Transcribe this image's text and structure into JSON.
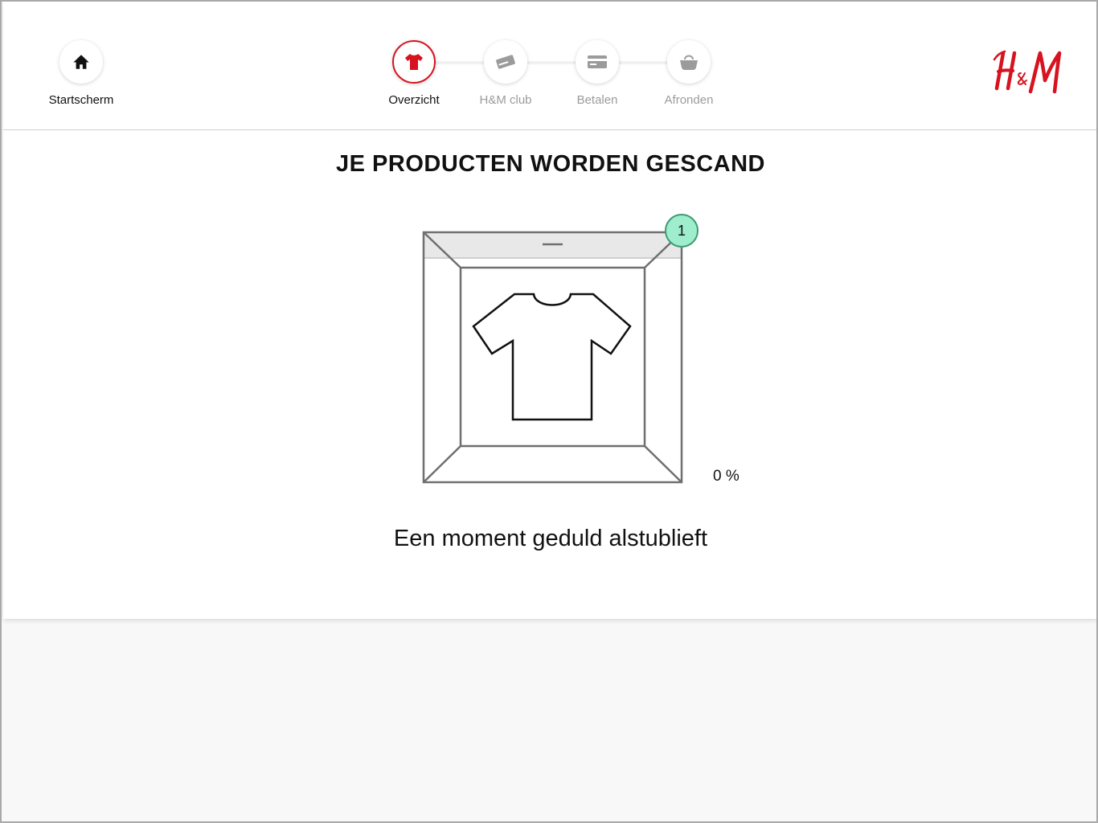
{
  "header": {
    "home": {
      "label": "Startscherm",
      "icon": "home-icon"
    },
    "steps": [
      {
        "label": "Overzicht",
        "icon": "tshirt-icon",
        "state": "active"
      },
      {
        "label": "H&M club",
        "icon": "card-icon",
        "state": "upcoming"
      },
      {
        "label": "Betalen",
        "icon": "payment-card-icon",
        "state": "upcoming"
      },
      {
        "label": "Afronden",
        "icon": "bag-icon",
        "state": "upcoming"
      }
    ],
    "logo_text": "H&M"
  },
  "main": {
    "title": "JE PRODUCTEN WORDEN GESCAND",
    "item_count": "1",
    "progress_text": "0 %",
    "progress_value": 0,
    "wait_message": "Een moment geduld alstublieft"
  },
  "colors": {
    "brand_red": "#d6131f",
    "badge_fill": "#9eedcc",
    "badge_border": "#3f9a75",
    "inactive_text": "#9b9b9b"
  }
}
